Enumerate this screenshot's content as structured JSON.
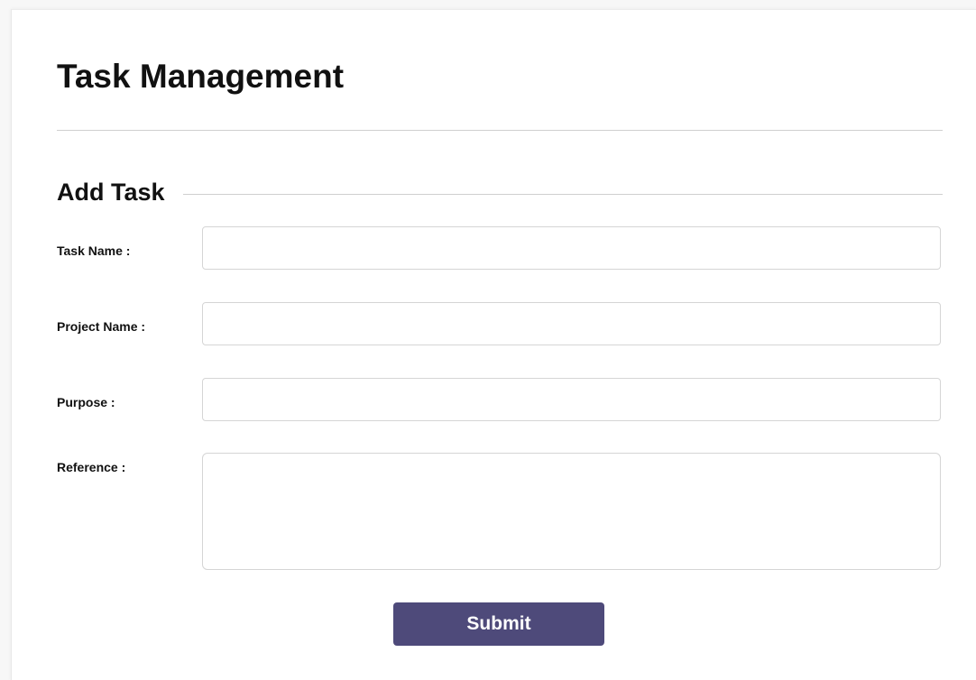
{
  "page": {
    "title": "Task Management"
  },
  "form": {
    "section_title": "Add Task",
    "fields": [
      {
        "label": "Task Name :",
        "value": "",
        "placeholder": ""
      },
      {
        "label": "Project Name :",
        "value": "",
        "placeholder": ""
      },
      {
        "label": "Purpose :",
        "value": "",
        "placeholder": ""
      },
      {
        "label": "Reference :",
        "value": "",
        "placeholder": ""
      }
    ],
    "submit_label": "Submit"
  },
  "colors": {
    "accent": "#4e4a7a",
    "divider": "#cfcfcf",
    "input_border": "#d5d5d5"
  }
}
